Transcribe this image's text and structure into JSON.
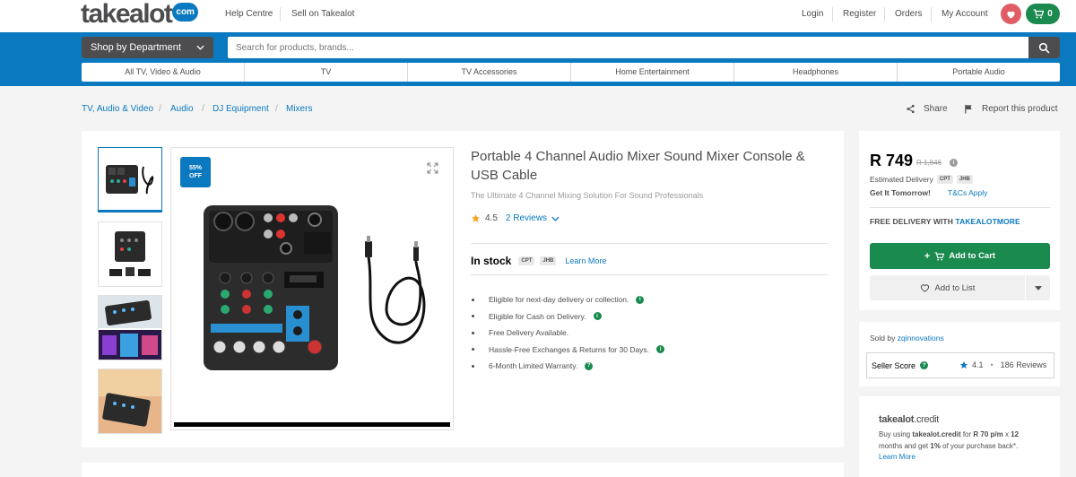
{
  "header": {
    "logo_text": "takealot",
    "logo_badge": "com",
    "links": [
      "Help Centre",
      "Sell on Takealot"
    ],
    "account_links": [
      "Login",
      "Register",
      "Orders",
      "My Account"
    ],
    "cart_count": "0"
  },
  "nav": {
    "shop_by_department": "Shop by Department",
    "search_placeholder": "Search for products, brands...",
    "categories": [
      "All TV, Video & Audio",
      "TV",
      "TV Accessories",
      "Home Entertainment",
      "Headphones",
      "Portable Audio"
    ]
  },
  "breadcrumb": [
    "TV, Audio & Video",
    "Audio",
    "DJ Equipment",
    "Mixers"
  ],
  "actions": {
    "share": "Share",
    "report": "Report this product"
  },
  "product": {
    "discount_line1": "55%",
    "discount_line2": "OFF",
    "title": "Portable 4 Channel Audio Mixer Sound Mixer Console & USB Cable",
    "subtitle": "The Ultimate 4 Channel Mixing Solution For Sound Professionals",
    "rating": "4.5",
    "reviews": "2 Reviews",
    "stock_label": "In stock",
    "stock_pills": [
      "CPT",
      "JHB"
    ],
    "learn_more": "Learn More",
    "bullets": [
      {
        "text": "Eligible for next-day delivery or collection.",
        "info": true
      },
      {
        "text": "Eligible for Cash on Delivery.",
        "info": true
      },
      {
        "text": "Free Delivery Available.",
        "info": false
      },
      {
        "text": "Hassle-Free Exchanges & Returns for 30 Days.",
        "info": true
      },
      {
        "text": "6-Month Limited Warranty.",
        "info": true
      }
    ]
  },
  "buybox": {
    "price": "R 749",
    "old_price": "R 1,846",
    "estimated_delivery": "Estimated Delivery",
    "delivery_pills": [
      "CPT",
      "JHB"
    ],
    "get_it": "Get It Tomorrow!",
    "tcs": "T&Cs Apply",
    "free_delivery_prefix": "FREE DELIVERY WITH ",
    "free_delivery_brand": "TAKEALOTMORE",
    "add_to_cart": "Add to Cart",
    "add_to_list": "Add to List"
  },
  "seller": {
    "sold_by_prefix": "Sold by ",
    "name": "zqinnovations",
    "score_label": "Seller Score",
    "score": "4.1",
    "reviews": "186 Reviews"
  },
  "credit": {
    "logo": "takealot",
    "logo_suffix": ".credit",
    "text_a": "Buy using ",
    "text_b": "takealot.credit",
    "text_c": " for ",
    "text_d": "R 70 p/m",
    "text_e": " x ",
    "text_f": "12",
    "text_g": " months and get ",
    "text_h": "1%",
    "text_i": " of your purchase back*.",
    "learn_more": "Learn More"
  },
  "colors": {
    "brand_blue": "#0b79bf",
    "brand_green": "#1a8a4e",
    "heart": "#e15d66",
    "text": "#4d4d4f"
  }
}
